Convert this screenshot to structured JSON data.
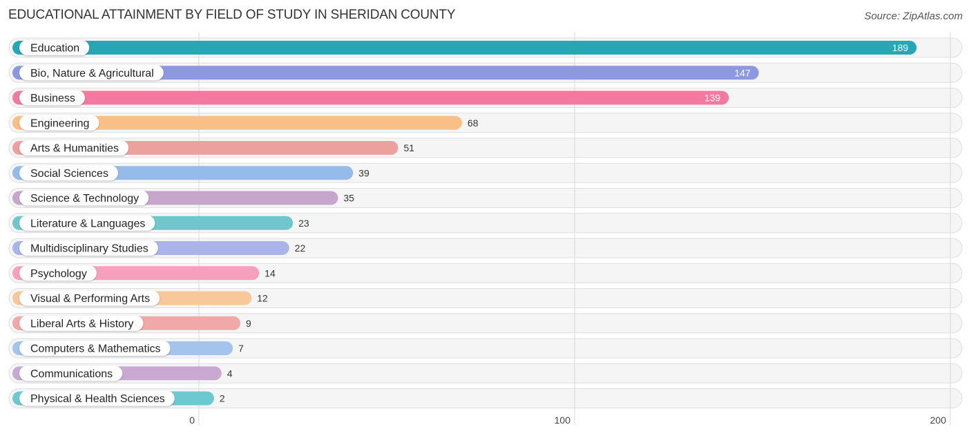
{
  "header": {
    "title": "EDUCATIONAL ATTAINMENT BY FIELD OF STUDY IN SHERIDAN COUNTY",
    "source": "Source: ZipAtlas.com"
  },
  "chart_data": {
    "type": "bar",
    "orientation": "horizontal",
    "title": "EDUCATIONAL ATTAINMENT BY FIELD OF STUDY IN SHERIDAN COUNTY",
    "xlabel": "",
    "ylabel": "",
    "xlim": [
      0,
      200
    ],
    "xticks": [
      0,
      100,
      200
    ],
    "grid": true,
    "categories": [
      "Education",
      "Bio, Nature & Agricultural",
      "Business",
      "Engineering",
      "Arts & Humanities",
      "Social Sciences",
      "Science & Technology",
      "Literature & Languages",
      "Multidisciplinary Studies",
      "Psychology",
      "Visual & Performing Arts",
      "Liberal Arts & History",
      "Computers & Mathematics",
      "Communications",
      "Physical & Health Sciences"
    ],
    "values": [
      189,
      147,
      139,
      68,
      51,
      39,
      35,
      23,
      22,
      14,
      12,
      9,
      7,
      4,
      2
    ],
    "colors": [
      "#27a6b5",
      "#8c99e0",
      "#f27aa0",
      "#f9bf87",
      "#eda19e",
      "#94bbe9",
      "#c7a6cc",
      "#6fc7cc",
      "#abb4e8",
      "#f7a0bd",
      "#f9c89a",
      "#f0a8a8",
      "#a3c4ec",
      "#c9a9d1",
      "#6ec8cf"
    ],
    "value_label_inside": [
      true,
      true,
      true,
      false,
      false,
      false,
      false,
      false,
      false,
      false,
      false,
      false,
      false,
      false,
      false
    ]
  }
}
